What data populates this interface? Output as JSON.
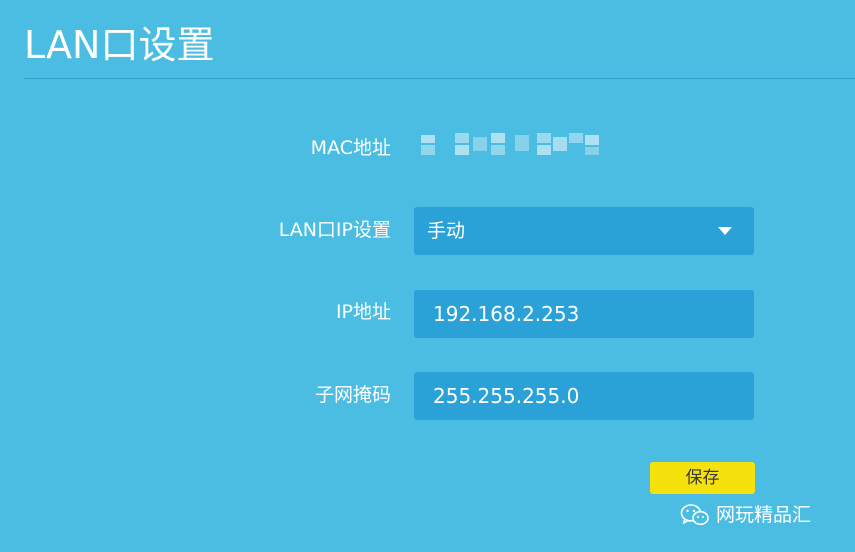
{
  "header": {
    "title": "LAN口设置"
  },
  "form": {
    "mac_label": "MAC地址",
    "lan_ip_mode_label": "LAN口IP设置",
    "lan_ip_mode_value": "手动",
    "ip_label": "IP地址",
    "ip_value": "192.168.2.253",
    "subnet_label": "子网掩码",
    "subnet_value": "255.255.255.0",
    "save_label": "保存"
  },
  "watermark": {
    "icon": "wechat-icon",
    "text": "网玩精品汇"
  },
  "colors": {
    "background": "#4bbde2",
    "field": "#2aa2d8",
    "save_button": "#f5e20c"
  }
}
